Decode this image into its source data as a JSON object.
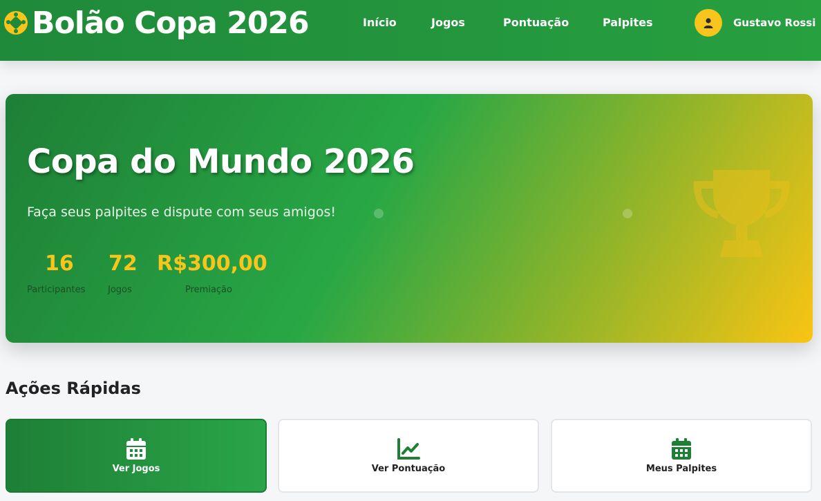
{
  "header": {
    "brand": "Bolão Copa 2026",
    "nav": [
      "Início",
      "Jogos",
      "Pontuação",
      "Palpites"
    ],
    "user_name": "Gustavo Rossi"
  },
  "hero": {
    "title": "Copa do Mundo 2026",
    "subtitle": "Faça seus palpites e dispute com seus amigos!",
    "stats": [
      {
        "value": "16",
        "label": "Participantes"
      },
      {
        "value": "72",
        "label": "Jogos"
      },
      {
        "value": "R$300,00",
        "label": "Premiação"
      }
    ]
  },
  "quick_actions": {
    "title": "Ações Rápidas",
    "items": [
      {
        "label": "Ver Jogos",
        "icon": "calendar-icon"
      },
      {
        "label": "Ver Pontuação",
        "icon": "chart-line-icon"
      },
      {
        "label": "Meus Palpites",
        "icon": "calendar-icon"
      }
    ]
  },
  "colors": {
    "primary_green": "#28a745",
    "dark_green": "#1e7f36",
    "accent_yellow": "#f7c51b"
  }
}
